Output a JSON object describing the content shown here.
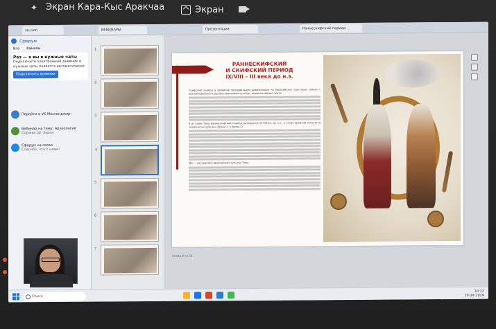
{
  "meeting": {
    "share_title": "Экран Кара-Кыс Аракчаа",
    "screen_label": "Экран"
  },
  "browser": {
    "tabs": [
      "vk.com",
      "ВЕБИНАРЫ",
      "Презентация",
      "Раннескифский период"
    ]
  },
  "messenger": {
    "header": "Сферум",
    "filter_all": "Все",
    "filter_channels": "Каналы",
    "promo_title": "Рез — я вы в нужные чаты",
    "promo_text": "Подключите электронный дневник и нужные чаты появятся автоматически",
    "promo_button": "Подключить дневник",
    "chats": [
      {
        "name": "Перейти в VK Мессенджер",
        "preview": ""
      },
      {
        "name": "Вебинар на тему: Археология",
        "preview": "Ооржак Ш. Ээрен"
      },
      {
        "name": "Сферум на связи",
        "preview": "Спасибо, что с нами!"
      }
    ]
  },
  "slide": {
    "title_line1": "РАННЕСКИФСКИЙ",
    "title_line2": "И СКИФСКИЙ ПЕРИОД",
    "title_line3": "IX/VIII – III века до н.э.",
    "paragraph1": "Скифский период в развитии материальной цивилизации на Евразийских просторах связан с возникновением и распространением культур, имевших общие черты.",
    "paragraph2": "В истории Тувы раннескифский период датируется IX–VIII вв. до н.э., к этому времени относятся знаменитые курганы Аржан-1 и Аржан-2.",
    "paragraph3": "Мы — наследники древнейших культур Тувы.",
    "footer": "Слайд 8 из 23"
  },
  "thumbnails": [
    "1",
    "2",
    "3",
    "4",
    "5",
    "6",
    "7",
    "8"
  ],
  "taskbar": {
    "search_placeholder": "Поиск",
    "time": "10:12",
    "date": "19.04.2024"
  }
}
